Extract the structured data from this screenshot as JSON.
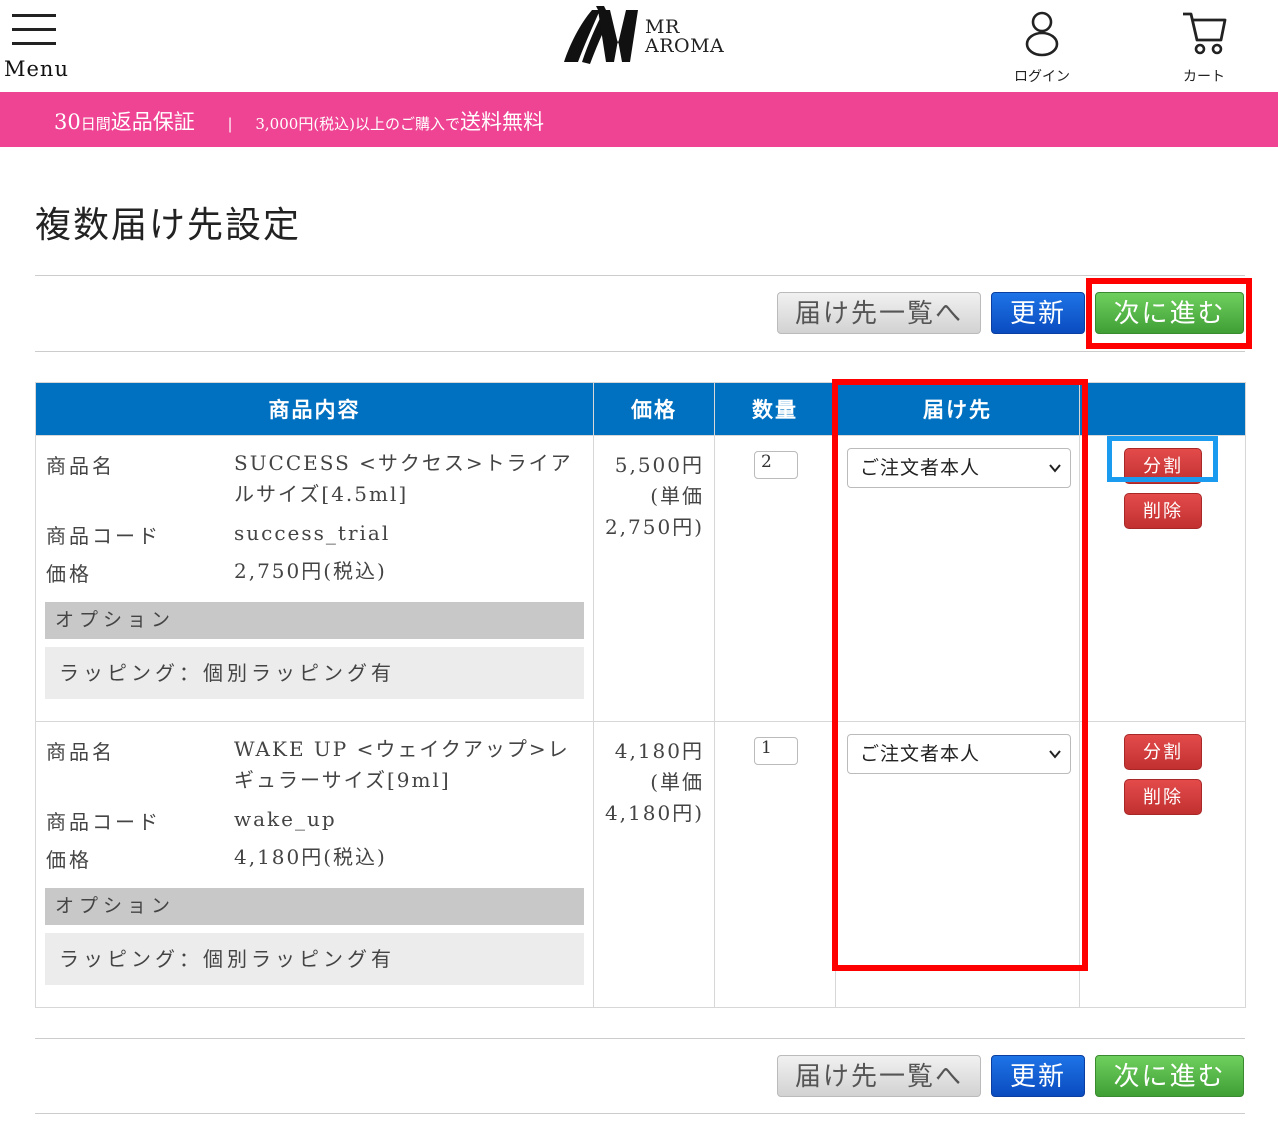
{
  "header": {
    "menu_label": "Menu",
    "logo_line1": "MR",
    "logo_line2": "AROMA",
    "login_label": "ログイン",
    "cart_label": "カート"
  },
  "promo": {
    "days": "30",
    "days_unit": "日間",
    "guarantee": "返品保証",
    "separator": "|",
    "threshold": "3,000円(税込)以上のご購入で",
    "free_shipping": "送料無料"
  },
  "page_title": "複数届け先設定",
  "buttons": {
    "address_list": "届け先一覧へ",
    "update": "更新",
    "next": "次に進む"
  },
  "table": {
    "headers": [
      "商品内容",
      "価格",
      "数量",
      "届け先",
      ""
    ],
    "labels": {
      "product_name": "商品名",
      "product_code": "商品コード",
      "price": "価格",
      "option_header": "オプション"
    },
    "rows": [
      {
        "name": "SUCCESS <サクセス>トライアルサイズ[4.5ml]",
        "code": "success_trial",
        "unit_price_tax": "2,750円(税込)",
        "option": "ラッピング：個別ラッピング有",
        "price_total": "5,500円",
        "price_unit_line1": "(単価",
        "price_unit_line2": "2,750円)",
        "qty": "2",
        "destination": "ご注文者本人",
        "split": "分割",
        "delete": "削除"
      },
      {
        "name": "WAKE UP <ウェイクアップ>レギュラーサイズ[9ml]",
        "code": "wake_up",
        "unit_price_tax": "4,180円(税込)",
        "option": "ラッピング：個別ラッピング有",
        "price_total": "4,180円",
        "price_unit_line1": "(単価",
        "price_unit_line2": "4,180円)",
        "qty": "1",
        "destination": "ご注文者本人",
        "split": "分割",
        "delete": "削除"
      }
    ]
  },
  "colors": {
    "promo_bg": "#ef4493",
    "table_header_bg": "#0070c0",
    "highlight_red": "#ff0000",
    "highlight_blue": "#1a9bf0",
    "update_button": "#0a4cc0",
    "next_button": "#3f9f35",
    "action_red": "#c23030"
  },
  "icons": [
    "hamburger-menu-icon",
    "brand-logo",
    "login-user-icon",
    "cart-icon",
    "chevron-down-icon"
  ]
}
